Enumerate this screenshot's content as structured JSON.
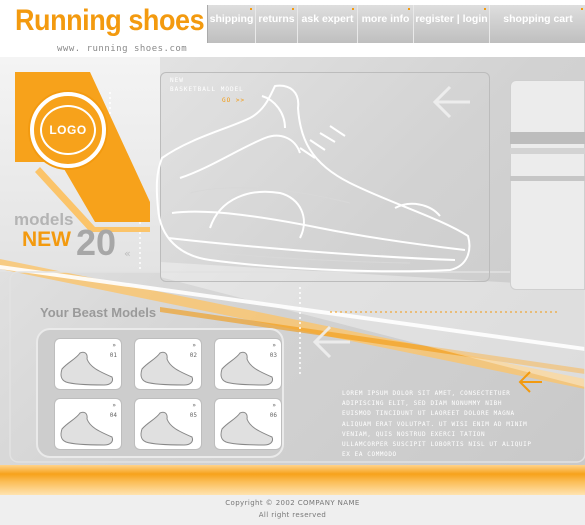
{
  "header": {
    "brand": "Running shoes",
    "url": "www. running shoes.com",
    "nav": [
      {
        "label": "shipping"
      },
      {
        "label": "returns"
      },
      {
        "label": "ask expert"
      },
      {
        "label": "more info"
      },
      {
        "label": "register | login"
      },
      {
        "label": "shopping cart"
      }
    ]
  },
  "logo": {
    "text": "LOGO"
  },
  "promo": {
    "models": "models",
    "new": "NEW",
    "count": "20",
    "chevron": "«"
  },
  "feature": {
    "tag_line1": "NEW",
    "tag_line2": "BASKETBALL MODEL",
    "tag_line3": "GO >>"
  },
  "beast": {
    "title": "Your Beast Models",
    "thumbs": [
      {
        "num": "01"
      },
      {
        "num": "02"
      },
      {
        "num": "03"
      },
      {
        "num": "04"
      },
      {
        "num": "05"
      },
      {
        "num": "06"
      }
    ],
    "thumb_chevron": "»"
  },
  "lorem": "LOREM IPSUM DOLOR SIT AMET, CONSECTETUER ADIPISCING ELIT, SED DIAM NONUMMY NIBH EUISMOD TINCIDUNT UT LAOREET DOLORE MAGNA ALIQUAM ERAT VOLUTPAT. UT WISI ENIM AD MINIM VENIAM, QUIS NOSTRUD EXERCI TATION ULLAMCORPER SUSCIPIT LOBORTIS NISL UT ALIQUIP EX EA COMMODO",
  "footer": {
    "copyright": "Copyright © 2002 COMPANY NAME",
    "rights": "All right reserved"
  },
  "colors": {
    "accent": "#f39a0f",
    "gray": "#bdbdbd"
  }
}
